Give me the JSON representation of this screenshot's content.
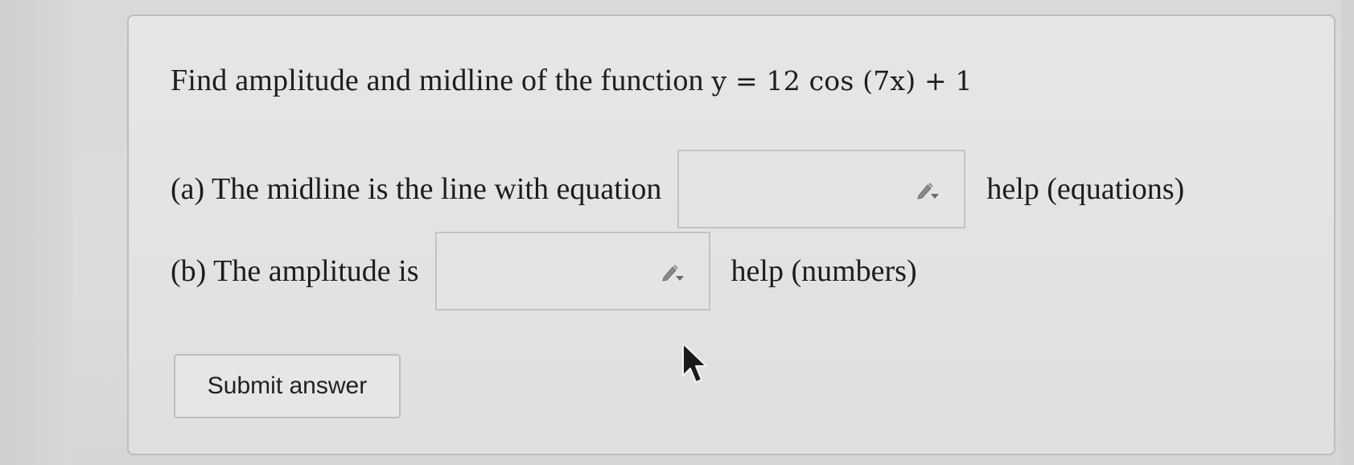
{
  "question": {
    "prefix": "Find amplitude and midline of the function",
    "function_math": "y = 12 cos (7x) + 1"
  },
  "part_a": {
    "label": "(a) The midline is the line with equation",
    "input_value": "",
    "help_text": "help (equations)"
  },
  "part_b": {
    "label": "(b) The amplitude is",
    "input_value": "",
    "help_text": "help (numbers)"
  },
  "submit": {
    "label": "Submit answer"
  },
  "icons": {
    "answer_tool": "pencil-dropdown-icon",
    "pointer": "mouse-cursor-icon"
  }
}
